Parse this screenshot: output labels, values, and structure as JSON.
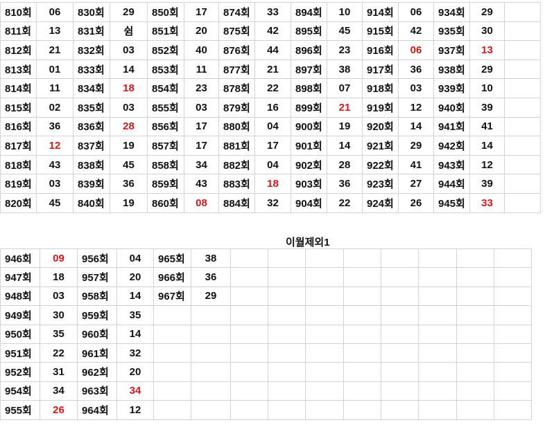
{
  "top_table": {
    "rows": [
      [
        [
          "810회",
          "06"
        ],
        [
          "830회",
          "29"
        ],
        [
          "850회",
          "17"
        ],
        [
          "874회",
          "33"
        ],
        [
          "894회",
          "10"
        ],
        [
          "914회",
          "06"
        ],
        [
          "934회",
          "29"
        ]
      ],
      [
        [
          "811회",
          "13"
        ],
        [
          "831회",
          "쉼"
        ],
        [
          "851회",
          "20"
        ],
        [
          "875회",
          "42"
        ],
        [
          "895회",
          "45"
        ],
        [
          "915회",
          "42"
        ],
        [
          "935회",
          "30"
        ]
      ],
      [
        [
          "812회",
          "21"
        ],
        [
          "832회",
          "03"
        ],
        [
          "852회",
          "40"
        ],
        [
          "876회",
          "44"
        ],
        [
          "896회",
          "23"
        ],
        [
          "916회",
          "06"
        ],
        [
          "937회",
          "13"
        ]
      ],
      [
        [
          "813회",
          "01"
        ],
        [
          "833회",
          "14"
        ],
        [
          "853회",
          "11"
        ],
        [
          "877회",
          "21"
        ],
        [
          "897회",
          "38"
        ],
        [
          "917회",
          "36"
        ],
        [
          "938회",
          "29"
        ]
      ],
      [
        [
          "814회",
          "11"
        ],
        [
          "834회",
          "18"
        ],
        [
          "854회",
          "23"
        ],
        [
          "878회",
          "22"
        ],
        [
          "898회",
          "07"
        ],
        [
          "918회",
          "03"
        ],
        [
          "939회",
          "10"
        ]
      ],
      [
        [
          "815회",
          "02"
        ],
        [
          "835회",
          "03"
        ],
        [
          "855회",
          "03"
        ],
        [
          "879회",
          "16"
        ],
        [
          "899회",
          "21"
        ],
        [
          "919회",
          "12"
        ],
        [
          "940회",
          "39"
        ]
      ],
      [
        [
          "816회",
          "36"
        ],
        [
          "836회",
          "28"
        ],
        [
          "856회",
          "17"
        ],
        [
          "880회",
          "04"
        ],
        [
          "900회",
          "19"
        ],
        [
          "920회",
          "14"
        ],
        [
          "941회",
          "41"
        ]
      ],
      [
        [
          "817회",
          "12"
        ],
        [
          "837회",
          "19"
        ],
        [
          "857회",
          "17"
        ],
        [
          "881회",
          "17"
        ],
        [
          "901회",
          "14"
        ],
        [
          "921회",
          "29"
        ],
        [
          "942회",
          "14"
        ]
      ],
      [
        [
          "818회",
          "43"
        ],
        [
          "838회",
          "45"
        ],
        [
          "858회",
          "34"
        ],
        [
          "882회",
          "04"
        ],
        [
          "902회",
          "28"
        ],
        [
          "922회",
          "41"
        ],
        [
          "943회",
          "12"
        ]
      ],
      [
        [
          "819회",
          "03"
        ],
        [
          "839회",
          "36"
        ],
        [
          "859회",
          "43"
        ],
        [
          "883회",
          "18"
        ],
        [
          "903회",
          "36"
        ],
        [
          "923회",
          "27"
        ],
        [
          "944회",
          "39"
        ]
      ],
      [
        [
          "820회",
          "45"
        ],
        [
          "840회",
          "19"
        ],
        [
          "860회",
          "08"
        ],
        [
          "884회",
          "32"
        ],
        [
          "904회",
          "22"
        ],
        [
          "924회",
          "26"
        ],
        [
          "945회",
          "33"
        ]
      ]
    ],
    "red_cells": [
      "2-5",
      "2-6",
      "4-1",
      "5-4",
      "6-1",
      "7-0",
      "9-3",
      "10-2",
      "10-6"
    ]
  },
  "section_title": "이월제외1",
  "bottom_table": {
    "rows": [
      [
        [
          "946회",
          "09"
        ],
        [
          "956회",
          "04"
        ],
        [
          "965회",
          "38"
        ]
      ],
      [
        [
          "947회",
          "18"
        ],
        [
          "957회",
          "20"
        ],
        [
          "966회",
          "36"
        ]
      ],
      [
        [
          "948회",
          "03"
        ],
        [
          "958회",
          "14"
        ],
        [
          "967회",
          "29"
        ]
      ],
      [
        [
          "949회",
          "30"
        ],
        [
          "959회",
          "35"
        ],
        [
          "",
          ""
        ]
      ],
      [
        [
          "950회",
          "35"
        ],
        [
          "960회",
          "14"
        ],
        [
          "",
          ""
        ]
      ],
      [
        [
          "951회",
          "22"
        ],
        [
          "961회",
          "32"
        ],
        [
          "",
          ""
        ]
      ],
      [
        [
          "952회",
          "31"
        ],
        [
          "962회",
          "20"
        ],
        [
          "",
          ""
        ]
      ],
      [
        [
          "954회",
          "34"
        ],
        [
          "963회",
          "34"
        ],
        [
          "",
          ""
        ]
      ],
      [
        [
          "955회",
          "26"
        ],
        [
          "964회",
          "12"
        ],
        [
          "",
          ""
        ]
      ]
    ],
    "red_cells": [
      "0-0",
      "7-1",
      "8-0"
    ]
  },
  "colors": {
    "red": "#d01818",
    "text": "#111111",
    "grid": "#d4d4d4"
  }
}
